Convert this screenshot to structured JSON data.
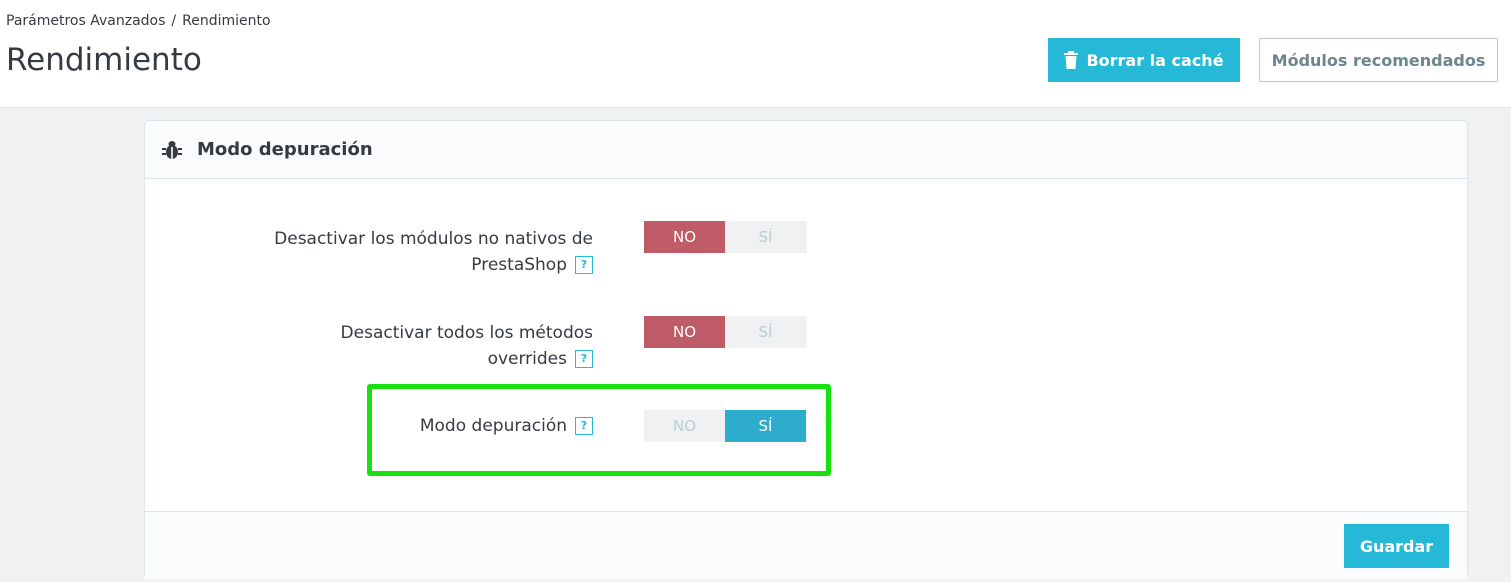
{
  "breadcrumb": {
    "parent": "Parámetros Avanzados",
    "separator": "/",
    "current": "Rendimiento"
  },
  "page": {
    "title": "Rendimiento"
  },
  "toolbar": {
    "clear_cache_label": "Borrar la caché",
    "recommended_modules_label": "Módulos recomendados"
  },
  "card": {
    "title": "Modo depuración",
    "icon": "bug-icon",
    "rows": [
      {
        "label_line1": "Desactivar los módulos no nativos de",
        "label_line2": "PrestaShop",
        "no": "NO",
        "yes": "SÍ",
        "value": "NO"
      },
      {
        "label_line1": "Desactivar todos los métodos",
        "label_line2": "overrides",
        "no": "NO",
        "yes": "SÍ",
        "value": "NO"
      },
      {
        "label_line1": "Modo depuración",
        "no": "NO",
        "yes": "SÍ",
        "value": "SÍ"
      }
    ],
    "help_symbol": "?",
    "save_label": "Guardar"
  },
  "colors": {
    "accent": "#25b9d7",
    "off": "#c05c67",
    "on": "#2eacce",
    "highlight": "#18e10f"
  }
}
